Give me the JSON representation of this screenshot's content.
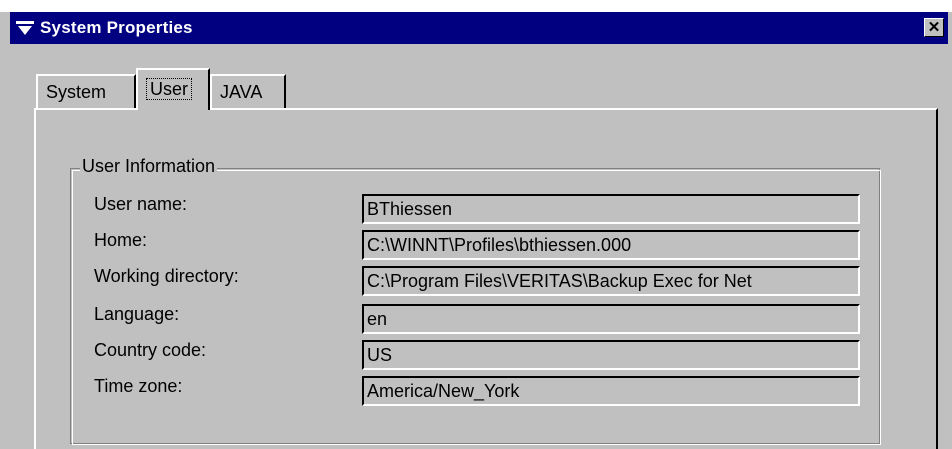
{
  "window": {
    "title": "System Properties",
    "close_label": "✕"
  },
  "tabs": [
    {
      "label": "System"
    },
    {
      "label": "User"
    },
    {
      "label": "JAVA"
    }
  ],
  "user_info": {
    "group_title": "User Information",
    "rows": [
      {
        "label": "User name:",
        "value": "BThiessen"
      },
      {
        "label": "Home:",
        "value": "C:\\WINNT\\Profiles\\bthiessen.000"
      },
      {
        "label": "Working directory:",
        "value": "C:\\Program Files\\VERITAS\\Backup Exec for Net"
      },
      {
        "label": "Language:",
        "value": "en"
      },
      {
        "label": "Country code:",
        "value": "US"
      },
      {
        "label": "Time zone:",
        "value": "America/New_York"
      }
    ]
  },
  "icons": {
    "title_icon": "menu-icon",
    "close_icon": "close-icon"
  }
}
